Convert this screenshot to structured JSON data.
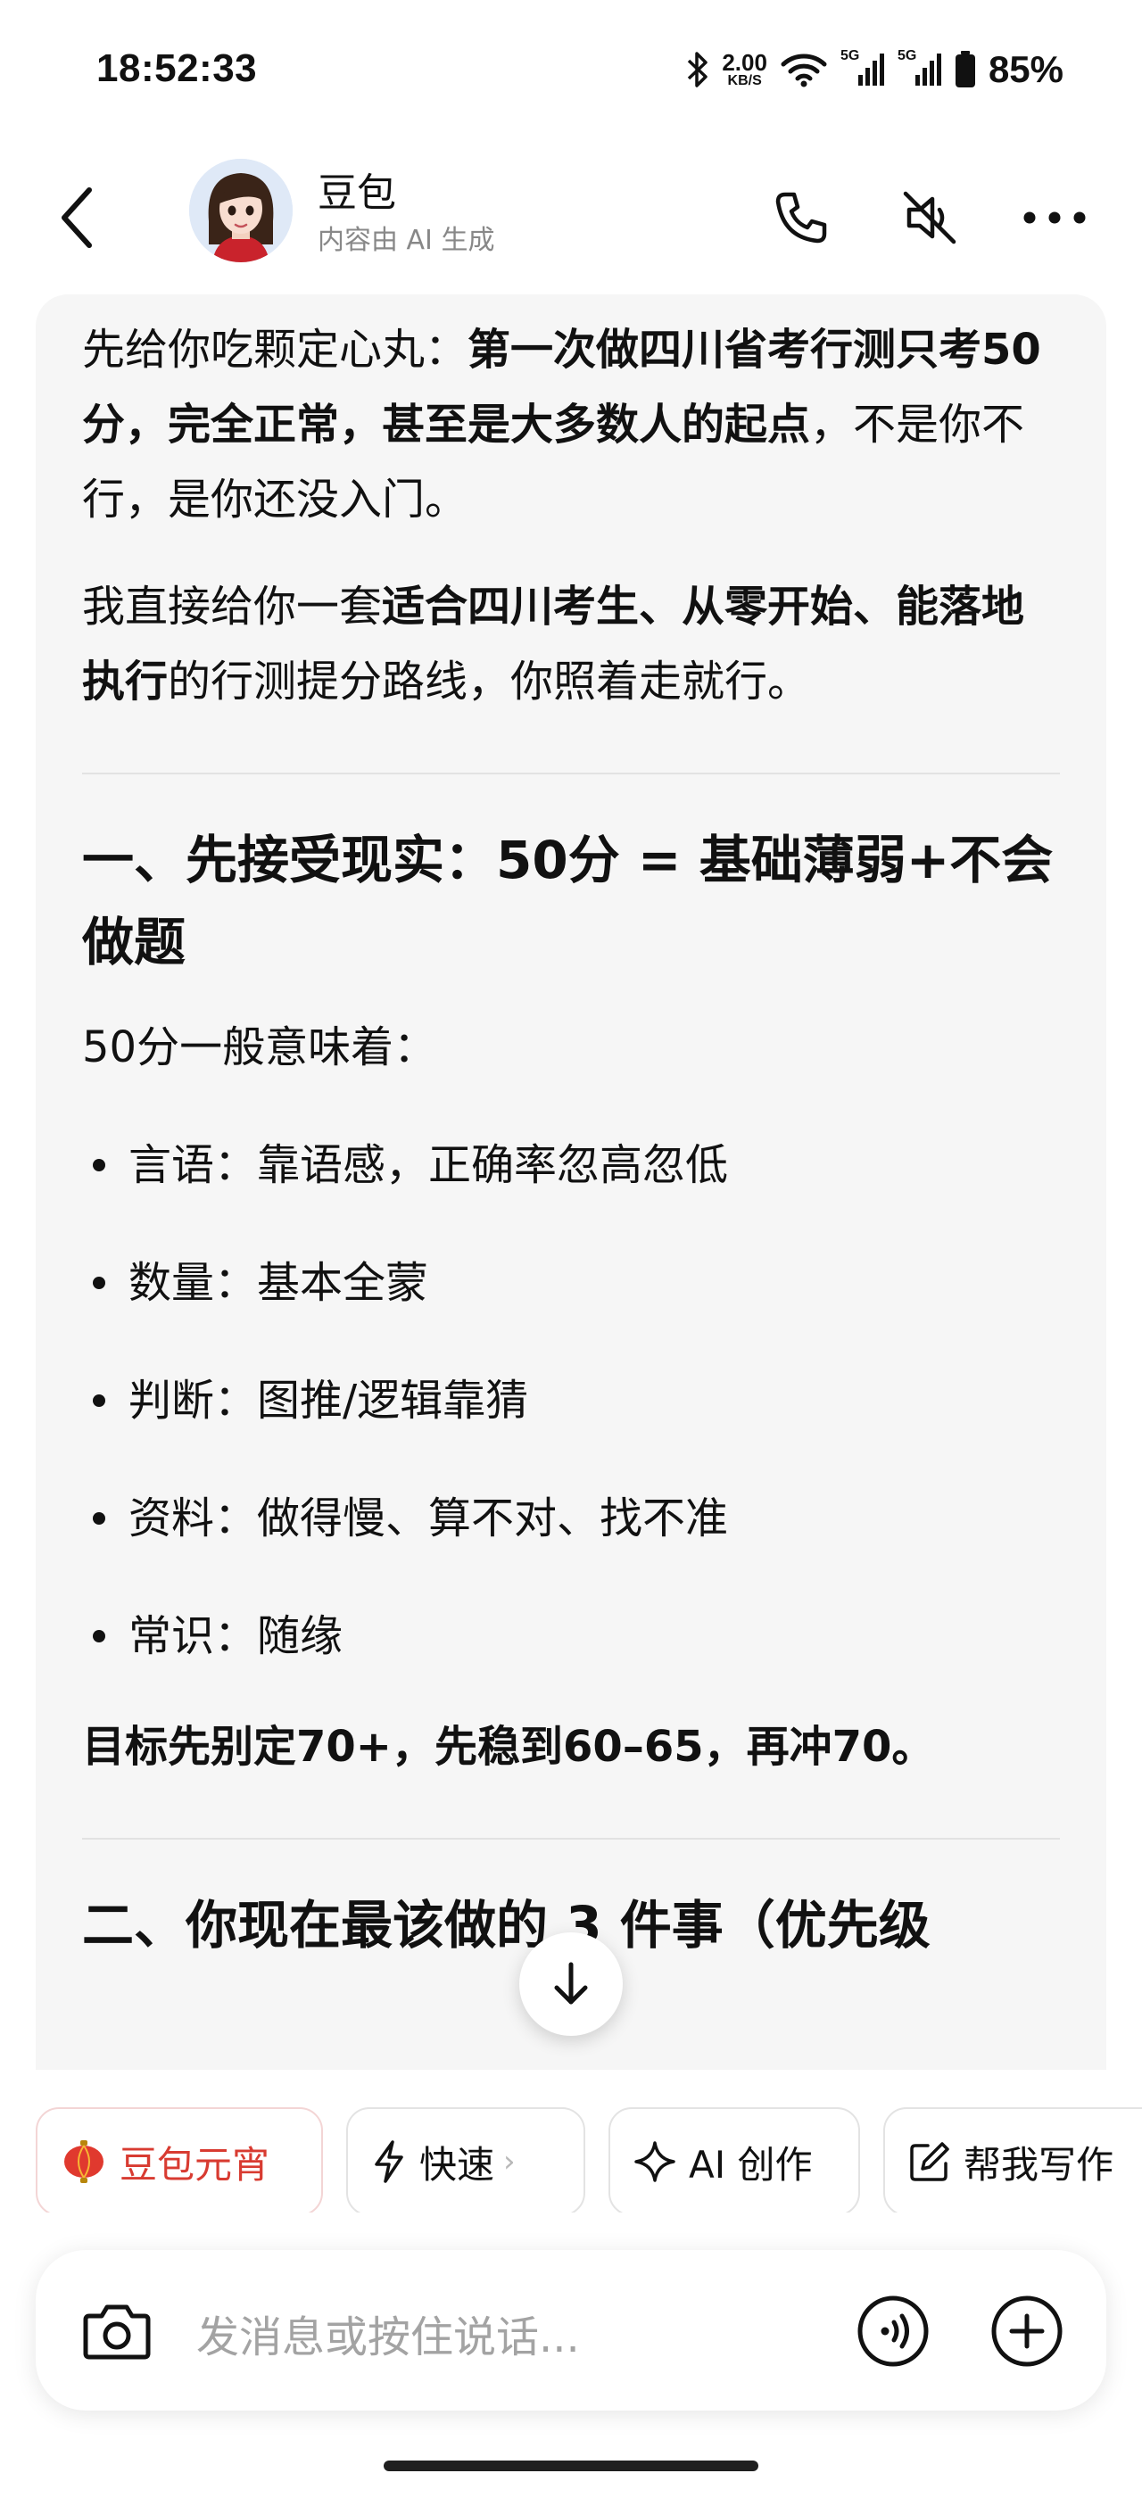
{
  "status_bar": {
    "time": "18:52:33",
    "net_speed_value": "2.00",
    "net_speed_unit": "KB/S",
    "signal_1_label": "5G",
    "signal_2_label": "5G",
    "battery": "85%"
  },
  "header": {
    "title": "豆包",
    "subtitle": "内容由 AI 生成"
  },
  "message": {
    "p1_a": "先给你吃颗定心丸：",
    "p1_b": "第一次做四川省考行测只考50分，完全正常，甚至是大多数人的起点",
    "p1_c": "，不是你不行，是你还没入门。",
    "p2_a": "我直接给你一套",
    "p2_b": "适合四川考生、从零开始、能落地执行",
    "p2_c": "的行测提分路线，你照着走就行。",
    "section1_title": "一、先接受现实：50分 = 基础薄弱+不会做题",
    "section1_intro": "50分一般意味着：",
    "bullets": [
      "言语：靠语感，正确率忽高忽低",
      "数量：基本全蒙",
      "判断：图推/逻辑靠猜",
      "资料：做得慢、算不对、找不准",
      "常识：随缘"
    ],
    "goal": "目标先别定70+，先稳到60–65，再冲70。",
    "section2_title": "二、你现在最该做的 3 件事（优先级"
  },
  "chips": [
    {
      "label": "豆包元宵",
      "icon": "lantern-icon"
    },
    {
      "label": "快速",
      "icon": "lightning-icon",
      "chevron": "›"
    },
    {
      "label": "AI 创作",
      "icon": "sparkle-icon"
    },
    {
      "label": "帮我写作",
      "icon": "edit-icon"
    }
  ],
  "input": {
    "placeholder": "发消息或按住说话..."
  },
  "colors": {
    "accent_red": "#d83b31",
    "bubble_bg": "#f6f6f6"
  }
}
